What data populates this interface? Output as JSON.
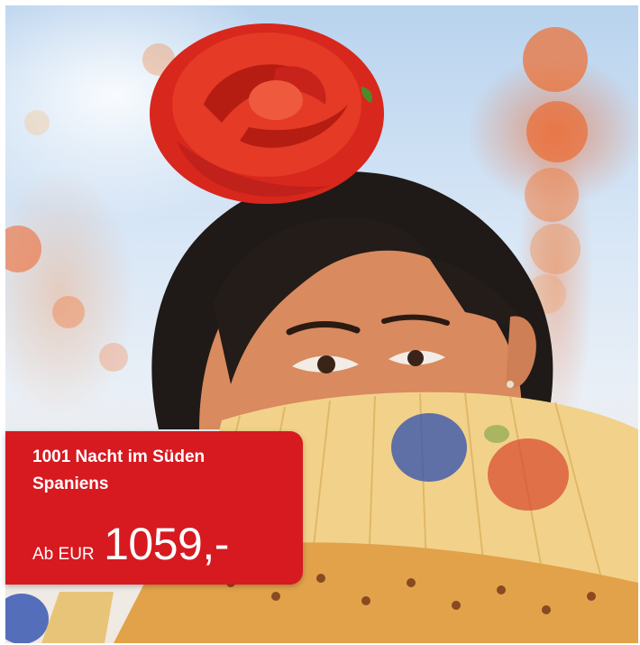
{
  "image": {
    "subject": "promo-photo"
  },
  "offer": {
    "title": "1001 Nacht im Süden Spaniens",
    "price_prefix": "Ab EUR",
    "price": "1059,-"
  },
  "colors": {
    "card_background": "#d71920",
    "text": "#ffffff"
  }
}
